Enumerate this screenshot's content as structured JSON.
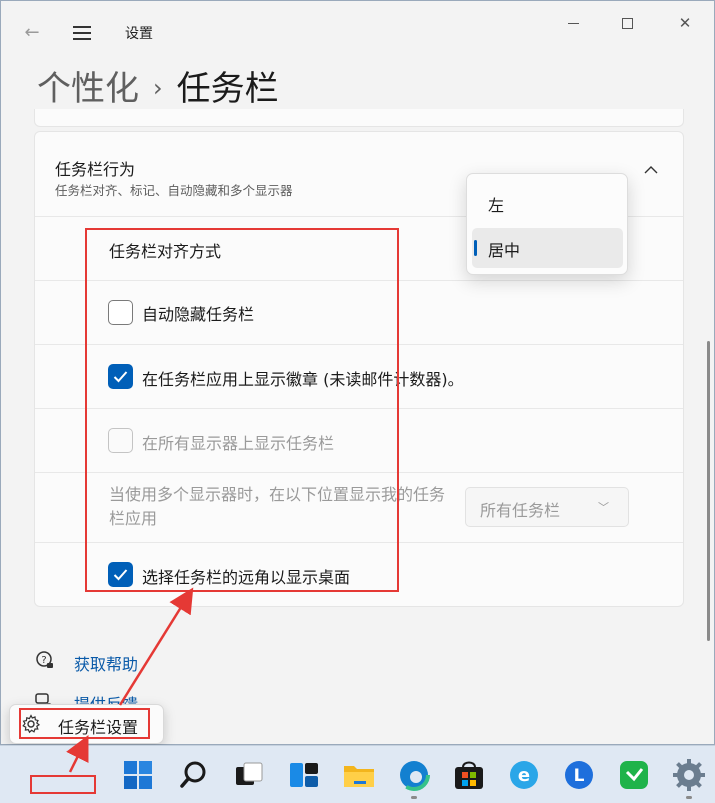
{
  "window": {
    "app_title": "设置",
    "breadcrumb_parent": "个性化",
    "breadcrumb_separator": "›",
    "breadcrumb_current": "任务栏"
  },
  "section": {
    "title": "任务栏行为",
    "subtitle": "任务栏对齐、标记、自动隐藏和多个显示器"
  },
  "settings": {
    "alignment_label": "任务栏对齐方式",
    "auto_hide": {
      "label": "自动隐藏任务栏",
      "checked": false
    },
    "show_badges": {
      "label": "在任务栏应用上显示徽章 (未读邮件计数器)。",
      "checked": true
    },
    "all_displays": {
      "label": "在所有显示器上显示任务栏",
      "checked": false,
      "disabled": true
    },
    "multi_display": {
      "label": "当使用多个显示器时，在以下位置显示我的任务栏应用",
      "selected": "所有任务栏"
    },
    "corner_desktop": {
      "label": "选择任务栏的远角以显示桌面",
      "checked": true
    }
  },
  "alignment_flyout": {
    "options": [
      "左",
      "居中"
    ],
    "selected": "居中"
  },
  "links": {
    "help": "获取帮助",
    "feedback": "提供反馈"
  },
  "context_menu": {
    "item": "任务栏设置"
  },
  "taskbar": {
    "icons": [
      "windows-start-icon",
      "search-icon",
      "task-view-icon",
      "widgets-icon",
      "file-explorer-icon",
      "edge-icon",
      "store-icon",
      "app-e-icon",
      "app-l-icon",
      "wechat-icon",
      "settings-icon"
    ]
  },
  "colors": {
    "accent": "#005fb8",
    "annotation_red": "#e53935",
    "link": "#0a5aa8"
  }
}
